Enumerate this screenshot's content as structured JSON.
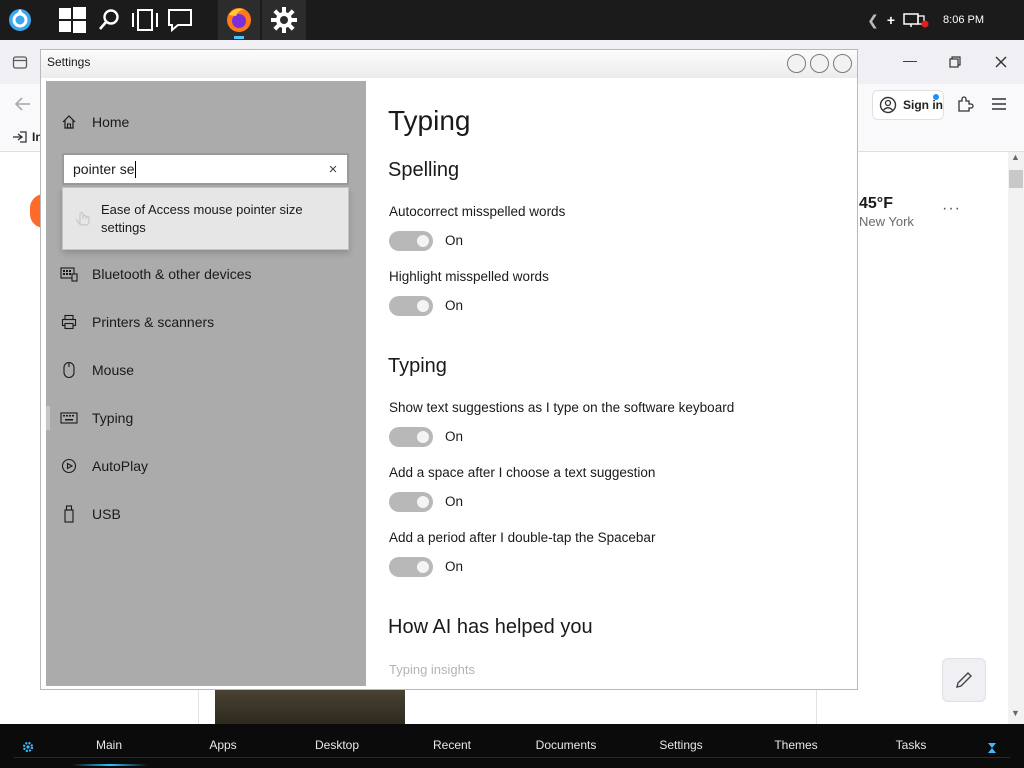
{
  "taskbar": {
    "time": "8:06 PM",
    "icons": [
      "app-logo-icon",
      "windows-start-icon",
      "search-icon",
      "task-view-icon",
      "notifications-icon",
      "firefox-icon",
      "settings-gear-icon"
    ]
  },
  "browser": {
    "bookmark_label": "In",
    "sign_in_label": "Sign in",
    "weather_temp": "45°F",
    "weather_city": "New York",
    "more_label": "···"
  },
  "settings": {
    "title": "Settings",
    "search": {
      "value": "pointer se",
      "clear_icon": "×"
    },
    "suggestion": "Ease of Access mouse pointer size settings",
    "nav": {
      "home": "Home",
      "items": [
        {
          "label": "Bluetooth & other devices",
          "icon": "bluetooth-devices-icon"
        },
        {
          "label": "Printers & scanners",
          "icon": "printer-icon"
        },
        {
          "label": "Mouse",
          "icon": "mouse-icon"
        },
        {
          "label": "Typing",
          "icon": "keyboard-icon"
        },
        {
          "label": "AutoPlay",
          "icon": "autoplay-icon"
        },
        {
          "label": "USB",
          "icon": "usb-icon"
        }
      ]
    },
    "page_title": "Typing",
    "spelling": {
      "heading": "Spelling",
      "autocorrect_label": "Autocorrect misspelled words",
      "autocorrect_state": "On",
      "highlight_label": "Highlight misspelled words",
      "highlight_state": "On"
    },
    "typing": {
      "heading": "Typing",
      "suggestions_label": "Show text suggestions as I type on the software keyboard",
      "suggestions_state": "On",
      "space_label": "Add a space after I choose a text suggestion",
      "space_state": "On",
      "period_label": "Add a period after I double-tap the Spacebar",
      "period_state": "On"
    },
    "ai": {
      "heading": "How AI has helped you",
      "insights_link": "Typing insights"
    }
  },
  "dock": {
    "items": [
      "Main",
      "Apps",
      "Desktop",
      "Recent",
      "Documents",
      "Settings",
      "Themes",
      "Tasks"
    ]
  }
}
